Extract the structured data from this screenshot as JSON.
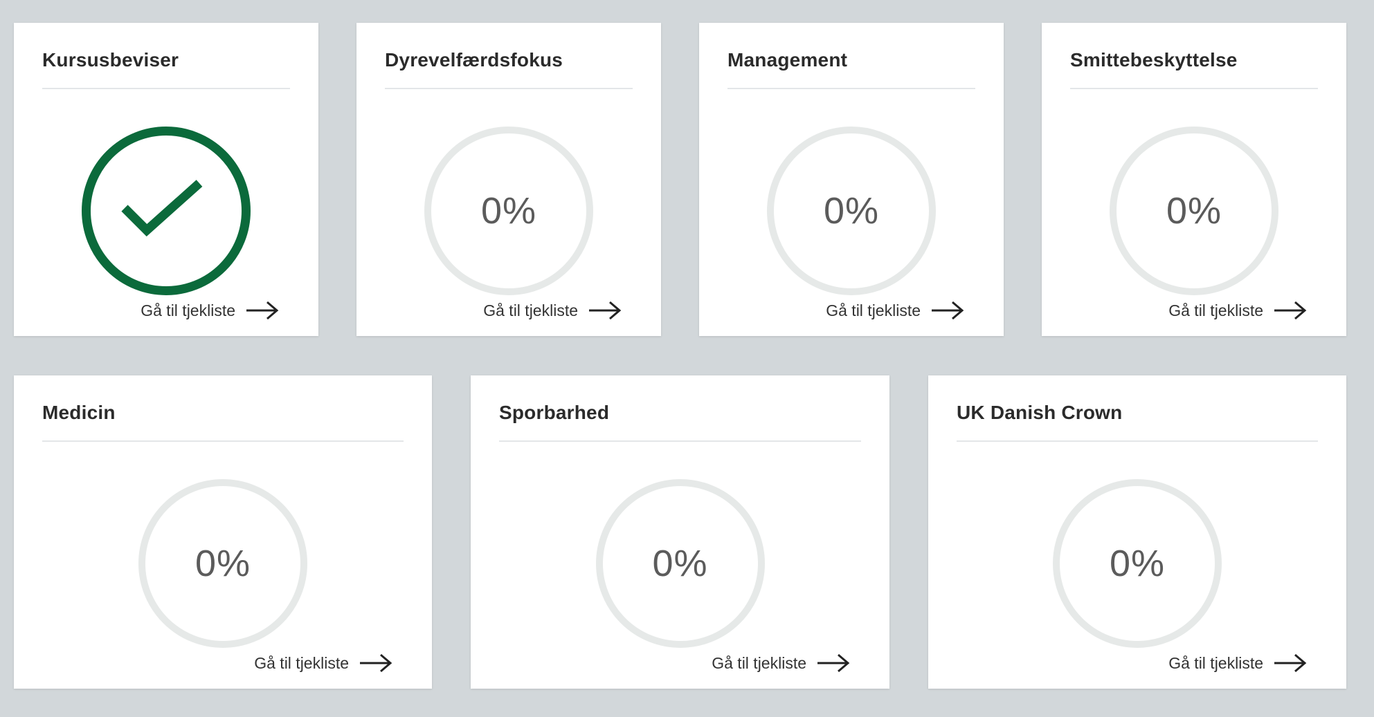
{
  "cards": [
    {
      "title": "Kursusbeviser",
      "status": "complete",
      "link_label": "Gå til tjekliste",
      "completed_icon": "check-icon",
      "accent_color": "#0b6a3b"
    },
    {
      "title": "Dyrevelfærdsfokus",
      "status": "in-progress",
      "progress_text": "0%",
      "progress_value": 0,
      "link_label": "Gå til tjekliste"
    },
    {
      "title": "Management",
      "status": "in-progress",
      "progress_text": "0%",
      "progress_value": 0,
      "link_label": "Gå til tjekliste"
    },
    {
      "title": "Smittebeskyttelse",
      "status": "in-progress",
      "progress_text": "0%",
      "progress_value": 0,
      "link_label": "Gå til tjekliste"
    },
    {
      "title": "Medicin",
      "status": "in-progress",
      "progress_text": "0%",
      "progress_value": 0,
      "link_label": "Gå til tjekliste"
    },
    {
      "title": "Sporbarhed",
      "status": "in-progress",
      "progress_text": "0%",
      "progress_value": 0,
      "link_label": "Gå til tjekliste"
    },
    {
      "title": "UK Danish Crown",
      "status": "in-progress",
      "progress_text": "0%",
      "progress_value": 0,
      "link_label": "Gå til tjekliste"
    }
  ],
  "icons": {
    "link_arrow": "arrow-right-icon",
    "progress_track_color": "#e6e9e8",
    "background_color": "#d2d7da"
  }
}
